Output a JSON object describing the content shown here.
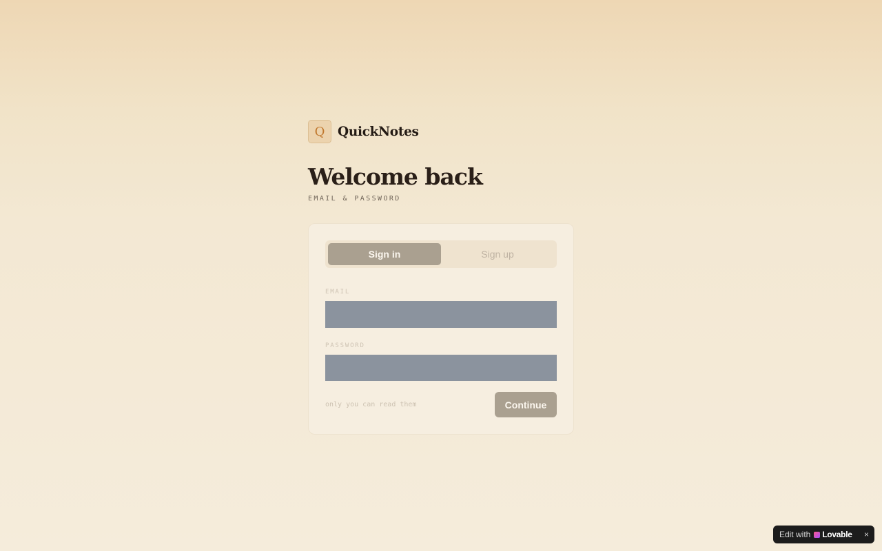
{
  "brand": {
    "logo_letter": "Q",
    "name": "QuickNotes"
  },
  "heading": {
    "title": "Welcome back",
    "subtitle": "EMAIL & PASSWORD"
  },
  "auth_tabs": {
    "sign_in": "Sign in",
    "sign_up": "Sign up",
    "active": "sign_in"
  },
  "form": {
    "email_label": "EMAIL",
    "email_value": "",
    "password_label": "PASSWORD",
    "password_value": "",
    "hint": "only you can read them",
    "submit_label": "Continue"
  },
  "badge": {
    "prefix": "Edit with",
    "brand": "Lovable",
    "close": "×"
  },
  "colors": {
    "accent": "#aaa090",
    "logo_bg": "#ecd3ae",
    "logo_letter": "#c0772c",
    "input_bg": "#8b939e",
    "badge_bg": "#1c1c1c"
  }
}
